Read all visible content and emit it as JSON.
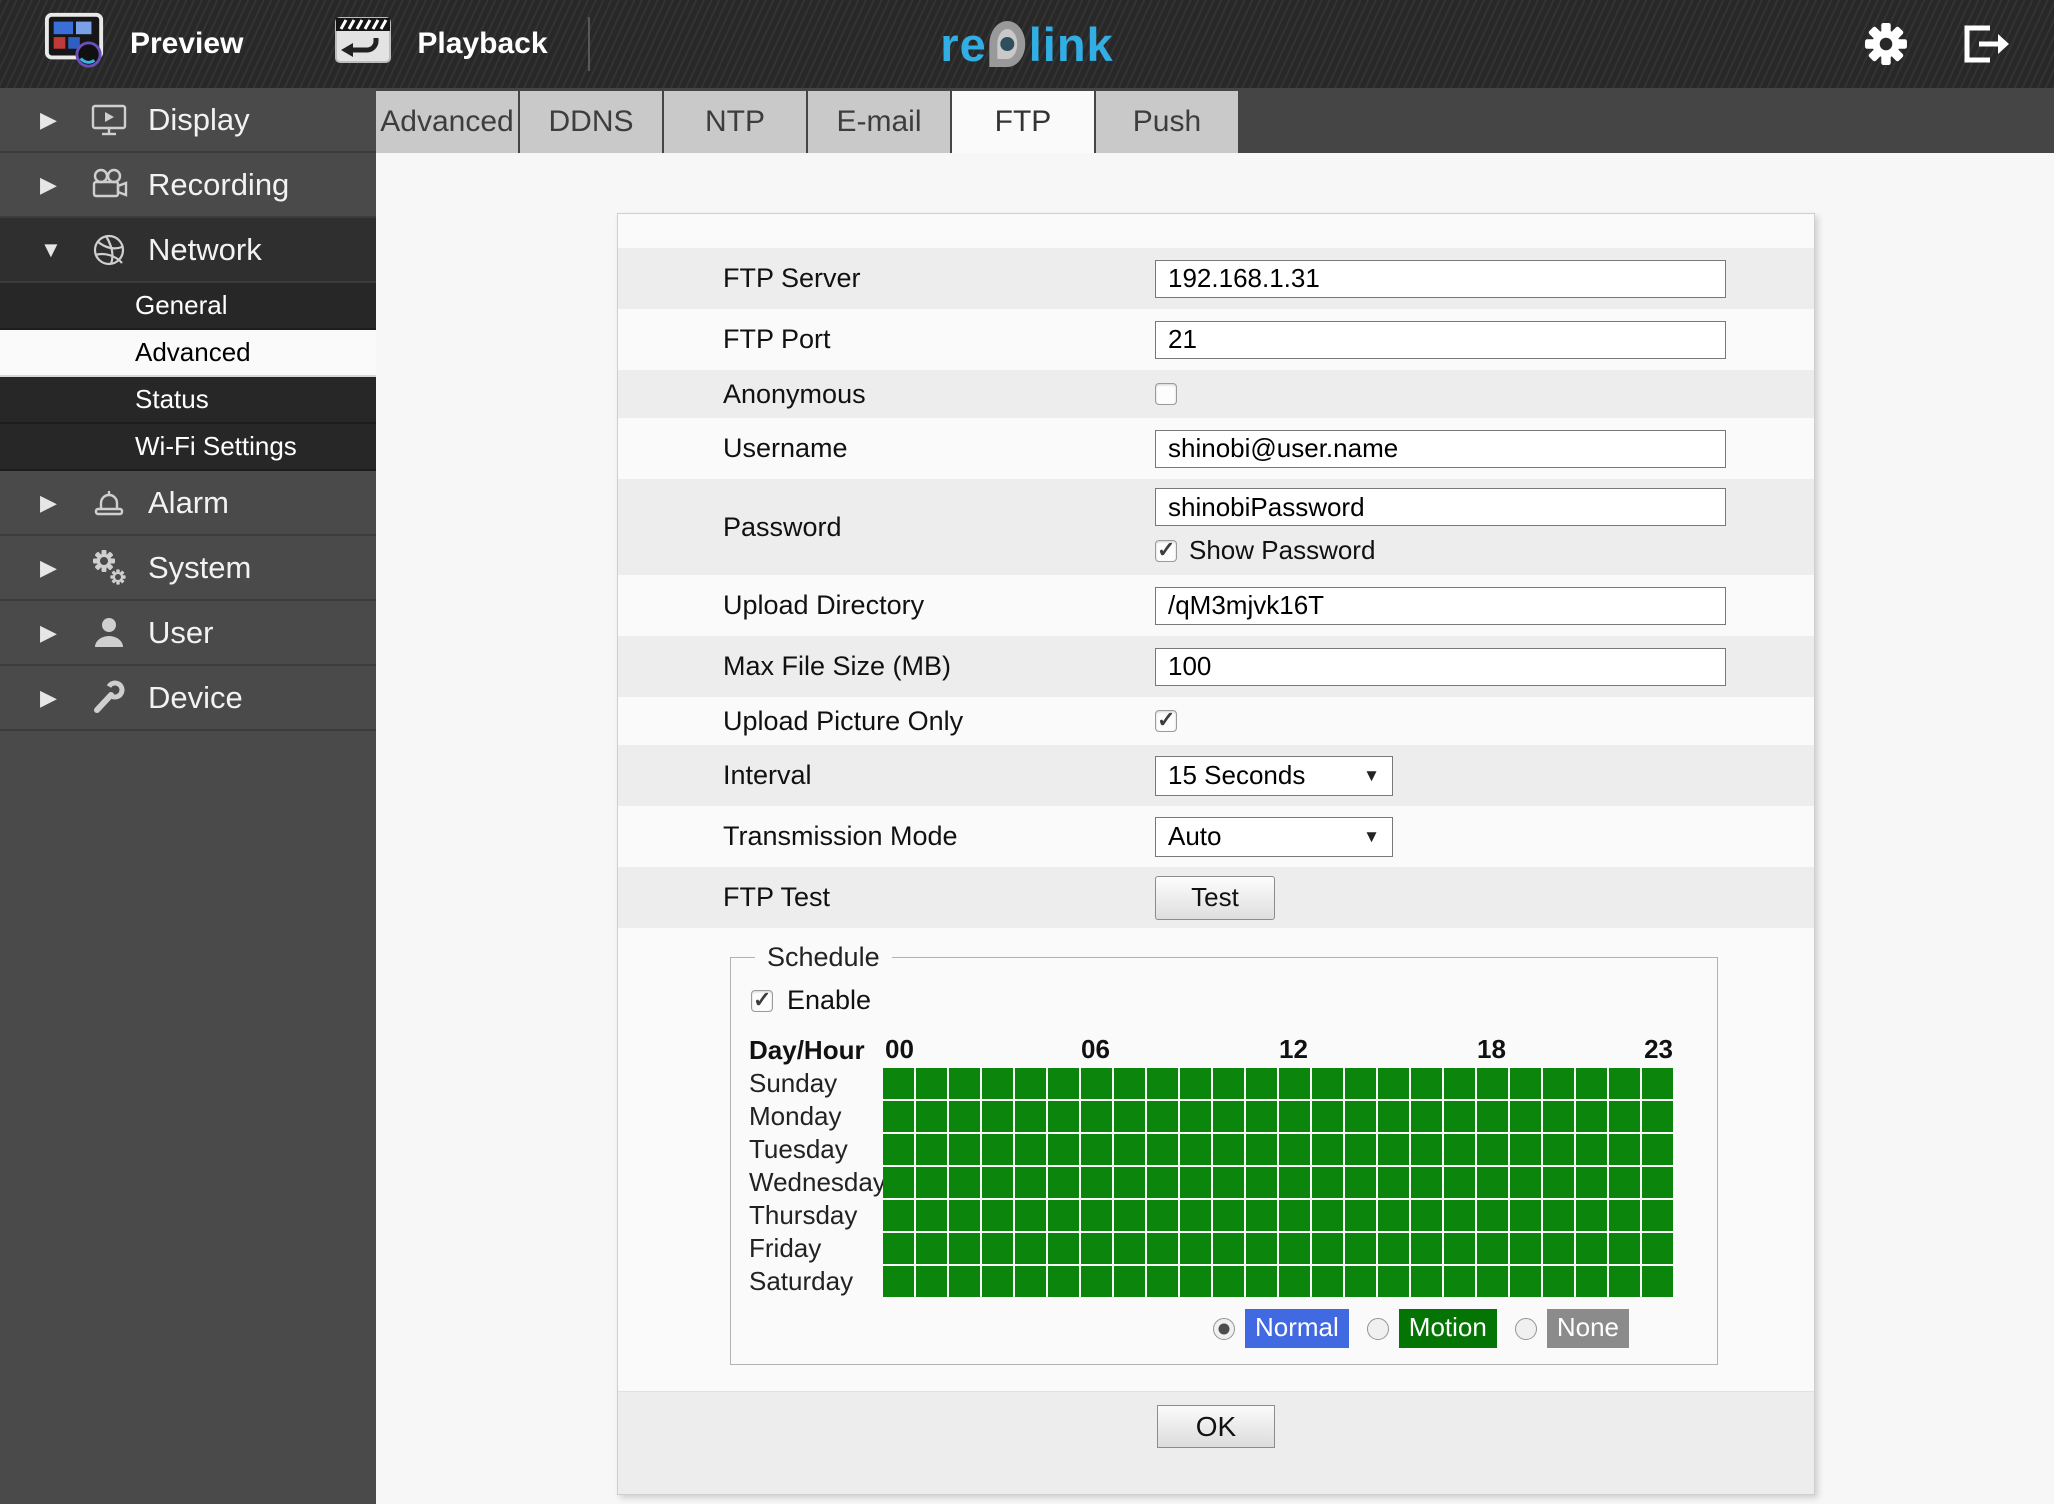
{
  "topbar": {
    "preview_label": "Preview",
    "playback_label": "Playback",
    "logo": {
      "text": "reolink",
      "left": "re",
      "right": "link"
    }
  },
  "sidebar": {
    "items": [
      {
        "label": "Display",
        "icon": "display-icon",
        "expanded": false
      },
      {
        "label": "Recording",
        "icon": "recording-icon",
        "expanded": false
      },
      {
        "label": "Network",
        "icon": "network-icon",
        "expanded": true,
        "children": [
          {
            "label": "General",
            "active": false
          },
          {
            "label": "Advanced",
            "active": true
          },
          {
            "label": "Status",
            "active": false
          },
          {
            "label": "Wi-Fi Settings",
            "active": false
          }
        ]
      },
      {
        "label": "Alarm",
        "icon": "alarm-icon",
        "expanded": false
      },
      {
        "label": "System",
        "icon": "system-icon",
        "expanded": false
      },
      {
        "label": "User",
        "icon": "user-icon",
        "expanded": false
      },
      {
        "label": "Device",
        "icon": "device-icon",
        "expanded": false
      }
    ]
  },
  "tabbar": {
    "tabs": [
      "Advanced",
      "DDNS",
      "NTP",
      "E-mail",
      "FTP",
      "Push"
    ],
    "active_tab": "FTP"
  },
  "form": {
    "rows": [
      {
        "label": "FTP Server",
        "value": "192.168.1.31"
      },
      {
        "label": "FTP Port",
        "value": "21"
      },
      {
        "label": "Anonymous",
        "checked": false
      },
      {
        "label": "Username",
        "value": "shinobi@user.name"
      },
      {
        "label": "Password",
        "value": "shinobiPassword",
        "show_password": {
          "label": "Show Password",
          "checked": true
        }
      },
      {
        "label": "Upload Directory",
        "value": "/qM3mjvk16T"
      },
      {
        "label": "Max File Size (MB)",
        "value": "100"
      },
      {
        "label": "Upload Picture Only",
        "checked": true
      },
      {
        "label": "Interval",
        "value": "15 Seconds"
      },
      {
        "label": "Transmission Mode",
        "value": "Auto"
      },
      {
        "label": "FTP Test",
        "button_label": "Test"
      }
    ],
    "ok_label": "OK"
  },
  "schedule": {
    "legend_label": "Schedule",
    "enable": {
      "label": "Enable",
      "checked": true
    },
    "day_hour_label": "Day/Hour",
    "hour_labels": [
      "00",
      "06",
      "12",
      "18",
      "23"
    ],
    "days": [
      "Sunday",
      "Monday",
      "Tuesday",
      "Wednesday",
      "Thursday",
      "Friday",
      "Saturday"
    ],
    "grid": {
      "columns": 24,
      "rows": 7,
      "all_selected": true,
      "cell_color": "#0c850c"
    },
    "modes": [
      {
        "label": "Normal",
        "color": "#4169e1",
        "selected": true
      },
      {
        "label": "Motion",
        "color": "#047404",
        "selected": false
      },
      {
        "label": "None",
        "color": "#8b8b8b",
        "selected": false
      }
    ]
  },
  "colors": {
    "logo_accent": "#31aee4"
  }
}
